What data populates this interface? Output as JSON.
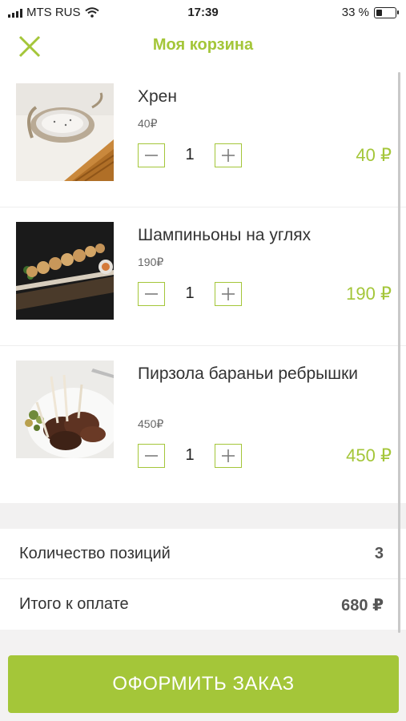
{
  "status": {
    "carrier": "MTS RUS",
    "time": "17:39",
    "battery": "33 %",
    "battery_level": 0.33
  },
  "header": {
    "title": "Моя корзина",
    "close_icon": "close-icon"
  },
  "items": [
    {
      "name": "Хрен",
      "unit_price": "40₽",
      "quantity": "1",
      "total": "40 ₽"
    },
    {
      "name": "Шампиньоны на углях",
      "unit_price": "190₽",
      "quantity": "1",
      "total": "190 ₽"
    },
    {
      "name": "Пирзола бараньи ребрышки",
      "unit_price": "450₽",
      "quantity": "1",
      "total": "450 ₽"
    }
  ],
  "summary": {
    "positions_label": "Количество позиций",
    "positions_value": "3",
    "total_label": "Итого к оплате",
    "total_value": "680 ₽"
  },
  "checkout": {
    "label": "ОФОРМИТЬ ЗАКАЗ"
  },
  "colors": {
    "accent": "#a4c639",
    "text": "#333333"
  }
}
